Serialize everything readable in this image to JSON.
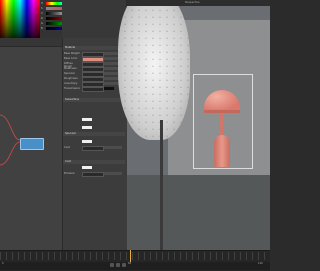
{
  "left": {
    "sliders": [
      {
        "label": "H",
        "value": "10.0"
      },
      {
        "label": "S",
        "value": "42.0"
      },
      {
        "label": "V",
        "value": "88.0"
      },
      {
        "label": "R",
        "value": "0.878"
      },
      {
        "label": "G",
        "value": "0.553"
      },
      {
        "label": "B",
        "value": "0.510"
      }
    ],
    "swatch_color": "#e08d82"
  },
  "attr": {
    "sections": [
      "Material",
      "Subsurface",
      "Specular",
      "Coat"
    ],
    "rows": [
      "Base Weight",
      "Base Color",
      "Diffuse Rough",
      "Metalness",
      "Specular",
      "Roughness",
      "Anisotropy",
      "Transmission",
      "Coat",
      "Emission"
    ]
  },
  "viewport": {
    "toolbar_text": "Perspective"
  },
  "timeline": {
    "frame_start": "0",
    "frame_end": "120",
    "current_frame": "60"
  }
}
